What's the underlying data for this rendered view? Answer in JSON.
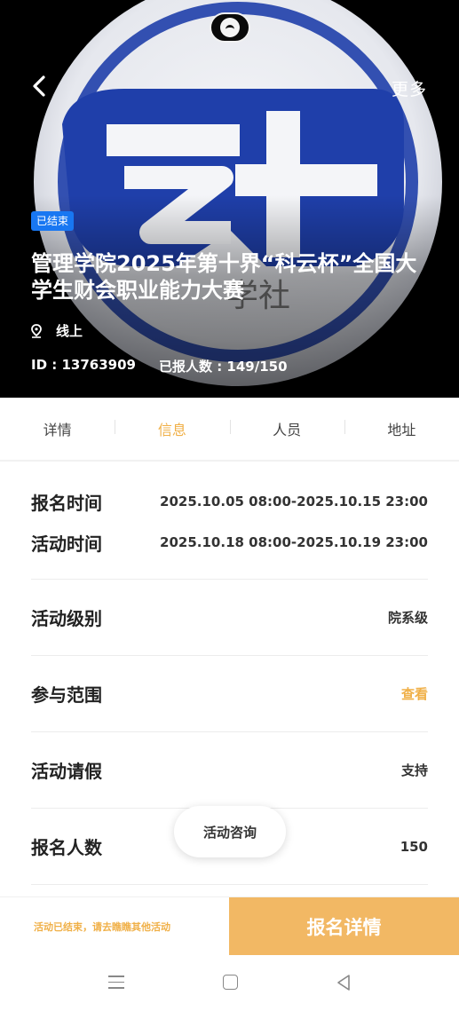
{
  "hero": {
    "more_label": "更多",
    "badge": "已结束",
    "title": "管理学院2025年第十界“科云杯”全国大学生财会职业能力大赛",
    "location": "线上",
    "id_text": "ID : 13763909",
    "enrolled_text": "已报人数 : 149/150"
  },
  "tabs": [
    {
      "label": "详情",
      "active": false
    },
    {
      "label": "信息",
      "active": true
    },
    {
      "label": "人员",
      "active": false
    },
    {
      "label": "地址",
      "active": false
    }
  ],
  "info": {
    "signup_time_label": "报名时间",
    "signup_time_value": "2025.10.05 08:00-2025.10.15 23:00",
    "activity_time_label": "活动时间",
    "activity_time_value": "2025.10.18 08:00-2025.10.19 23:00",
    "level_label": "活动级别",
    "level_value": "院系级",
    "scope_label": "参与范围",
    "scope_value": "查看",
    "leave_label": "活动请假",
    "leave_value": "支持",
    "count_label": "报名人数",
    "count_value": "150"
  },
  "consult_label": "活动咨询",
  "bottom": {
    "ended_message": "活动已结束，请去瞧瞧其他活动",
    "signup_button": "报名详情"
  },
  "colors": {
    "accent": "#f0b048",
    "button": "#f2b864",
    "badge": "#1877f2",
    "logo_blue": "#1f3faa"
  }
}
